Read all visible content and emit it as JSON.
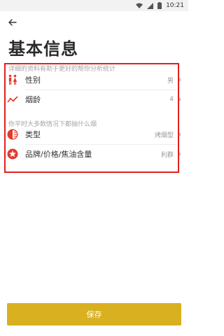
{
  "status_bar": {
    "time": "10:21"
  },
  "header": {
    "title": "基本信息"
  },
  "section1": {
    "hint": "详细的资料有助于更好的帮你分析统计",
    "rows": [
      {
        "label": "性别",
        "value": "男",
        "icon": "gender-icon"
      },
      {
        "label": "烟龄",
        "value": "4",
        "icon": "trend-icon"
      }
    ]
  },
  "section2": {
    "hint": "你平时大多数情况下都抽什么烟",
    "rows": [
      {
        "label": "类型",
        "value": "烤烟型",
        "icon": "type-icon"
      },
      {
        "label": "品牌/价格/焦油含量",
        "value": "利群",
        "icon": "star-icon"
      }
    ]
  },
  "footer": {
    "save_label": "保存"
  },
  "colors": {
    "accent_red": "#e0201d",
    "accent_yellow": "#d9b01f",
    "icon_red": "#e23a2c"
  }
}
